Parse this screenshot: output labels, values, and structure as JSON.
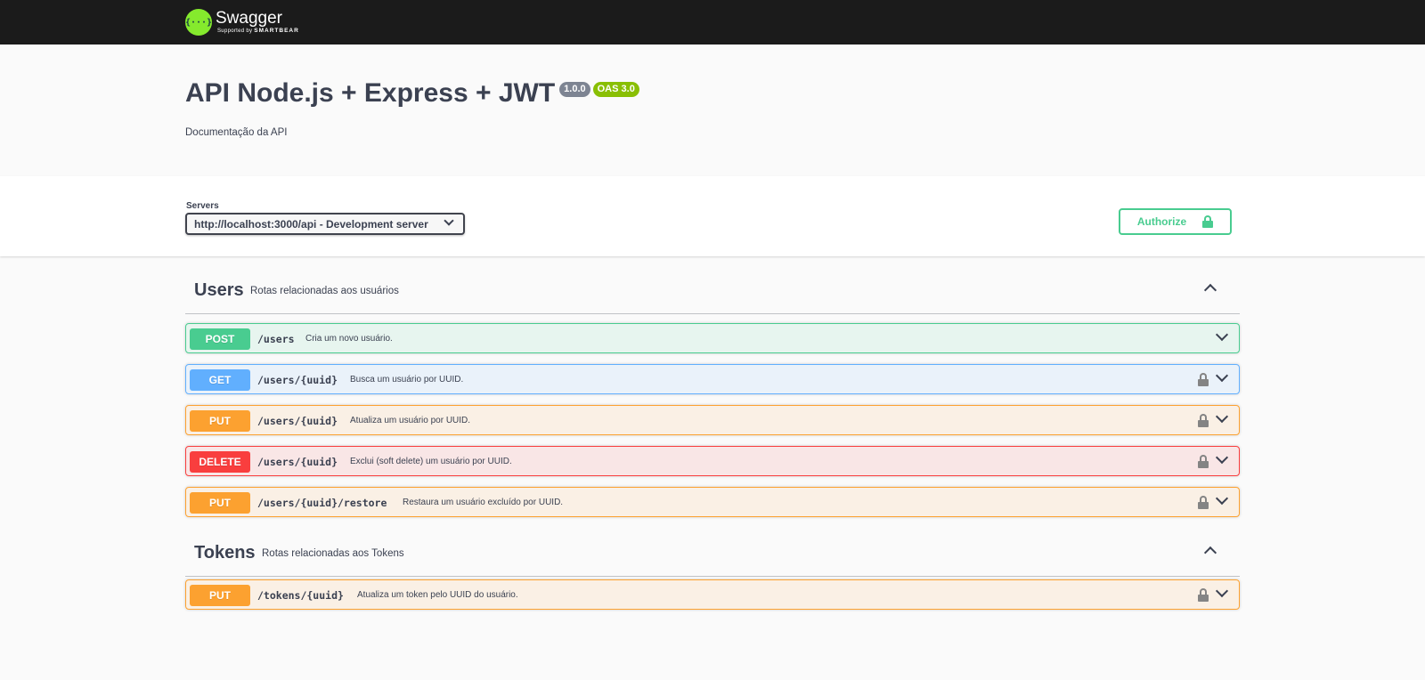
{
  "topbar": {
    "logo_icon": "{···}",
    "logo_name": "Swagger",
    "logo_sub_prefix": "Supported by",
    "logo_sub_brand": "SMARTBEAR"
  },
  "info": {
    "title": "API Node.js + Express + JWT",
    "version": "1.0.0",
    "oas": "OAS 3.0",
    "description": "Documentação da API"
  },
  "servers": {
    "label": "Servers",
    "selected": "http://localhost:3000/api - Development server"
  },
  "authorize": {
    "label": "Authorize"
  },
  "tags": [
    {
      "name": "Users",
      "description": "Rotas relacionadas aos usuários",
      "operations": [
        {
          "method": "POST",
          "path": "/users",
          "summary": "Cria um novo usuário."
        },
        {
          "method": "GET",
          "path": "/users/{uuid}",
          "summary": "Busca um usuário por UUID."
        },
        {
          "method": "PUT",
          "path": "/users/{uuid}",
          "summary": "Atualiza um usuário por UUID."
        },
        {
          "method": "DELETE",
          "path": "/users/{uuid}",
          "summary": "Exclui (soft delete) um usuário por UUID."
        },
        {
          "method": "PUT",
          "path": "/users/{uuid}/restore",
          "summary": "Restaura um usuário excluído por UUID."
        }
      ]
    },
    {
      "name": "Tokens",
      "description": "Rotas relacionadas aos Tokens",
      "operations": [
        {
          "method": "PUT",
          "path": "/tokens/{uuid}",
          "summary": "Atualiza um token pelo UUID do usuário."
        }
      ]
    }
  ],
  "colors": {
    "post": "#49cc90",
    "get": "#61affe",
    "put": "#fca130",
    "delete": "#f93e3e",
    "topbar": "#1b1b1b",
    "logo": "#85ea2d"
  },
  "icons": {
    "logo": "swagger-logo-icon",
    "authorize_lock": "unlocked-lock-icon",
    "operation_lock": "lock-icon",
    "expand": "chevron-down-icon",
    "collapse": "chevron-up-icon",
    "select": "chevron-down-icon"
  }
}
